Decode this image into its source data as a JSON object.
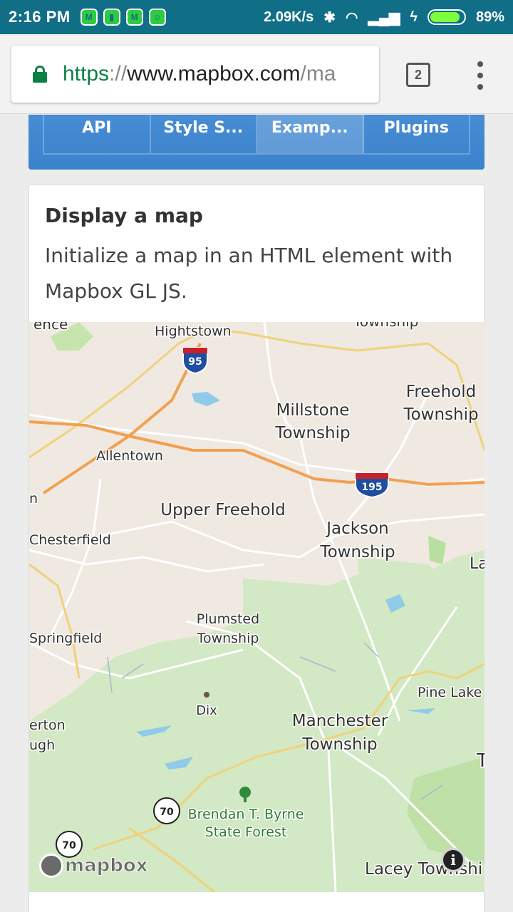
{
  "status_bar": {
    "time": "2:16 PM",
    "network_speed": "2.09K/s",
    "battery_percent": "89%",
    "battery_level": 0.89,
    "left_icons": [
      "M",
      "▮",
      "M",
      "☺"
    ]
  },
  "browser": {
    "url_scheme": "https",
    "url_separator": "://",
    "url_host": "www.mapbox.com",
    "url_path": "/ma",
    "tab_count": "2"
  },
  "nav": {
    "tabs": [
      {
        "label": "API"
      },
      {
        "label": "Style S..."
      },
      {
        "label": "Examp..."
      },
      {
        "label": "Plugins"
      }
    ]
  },
  "card": {
    "title": "Display a map",
    "description": "Initialize a map in an HTML element with Mapbox GL JS."
  },
  "map": {
    "labels": {
      "ence": "ence",
      "hightstown": "Hightstown",
      "township_top": "Township",
      "freehold_1": "Freehold",
      "freehold_2": "Township",
      "millstone_1": "Millstone",
      "millstone_2": "Township",
      "allentown": "Allentown",
      "upper_freehold": "Upper Freehold",
      "jackson_1": "Jackson",
      "jackson_2": "Township",
      "chesterfield": "Chesterfield",
      "la": "La",
      "plumsted_1": "Plumsted",
      "plumsted_2": "Township",
      "springfield": "Springfield",
      "pine_lake": "Pine Lake",
      "dix": "Dix",
      "erton": "erton",
      "ugh": "ugh",
      "manchester_1": "Manchester",
      "manchester_2": "Township",
      "t": "T",
      "byrne_1": "Brendan T. Byrne",
      "byrne_2": "State Forest",
      "lacey": "Lacey Townshi",
      "n": "n"
    },
    "shields": {
      "i95": "95",
      "i195": "195",
      "rt70a": "70",
      "rt70b": "70"
    },
    "logo_text": "mapbox",
    "info_icon": "i"
  }
}
